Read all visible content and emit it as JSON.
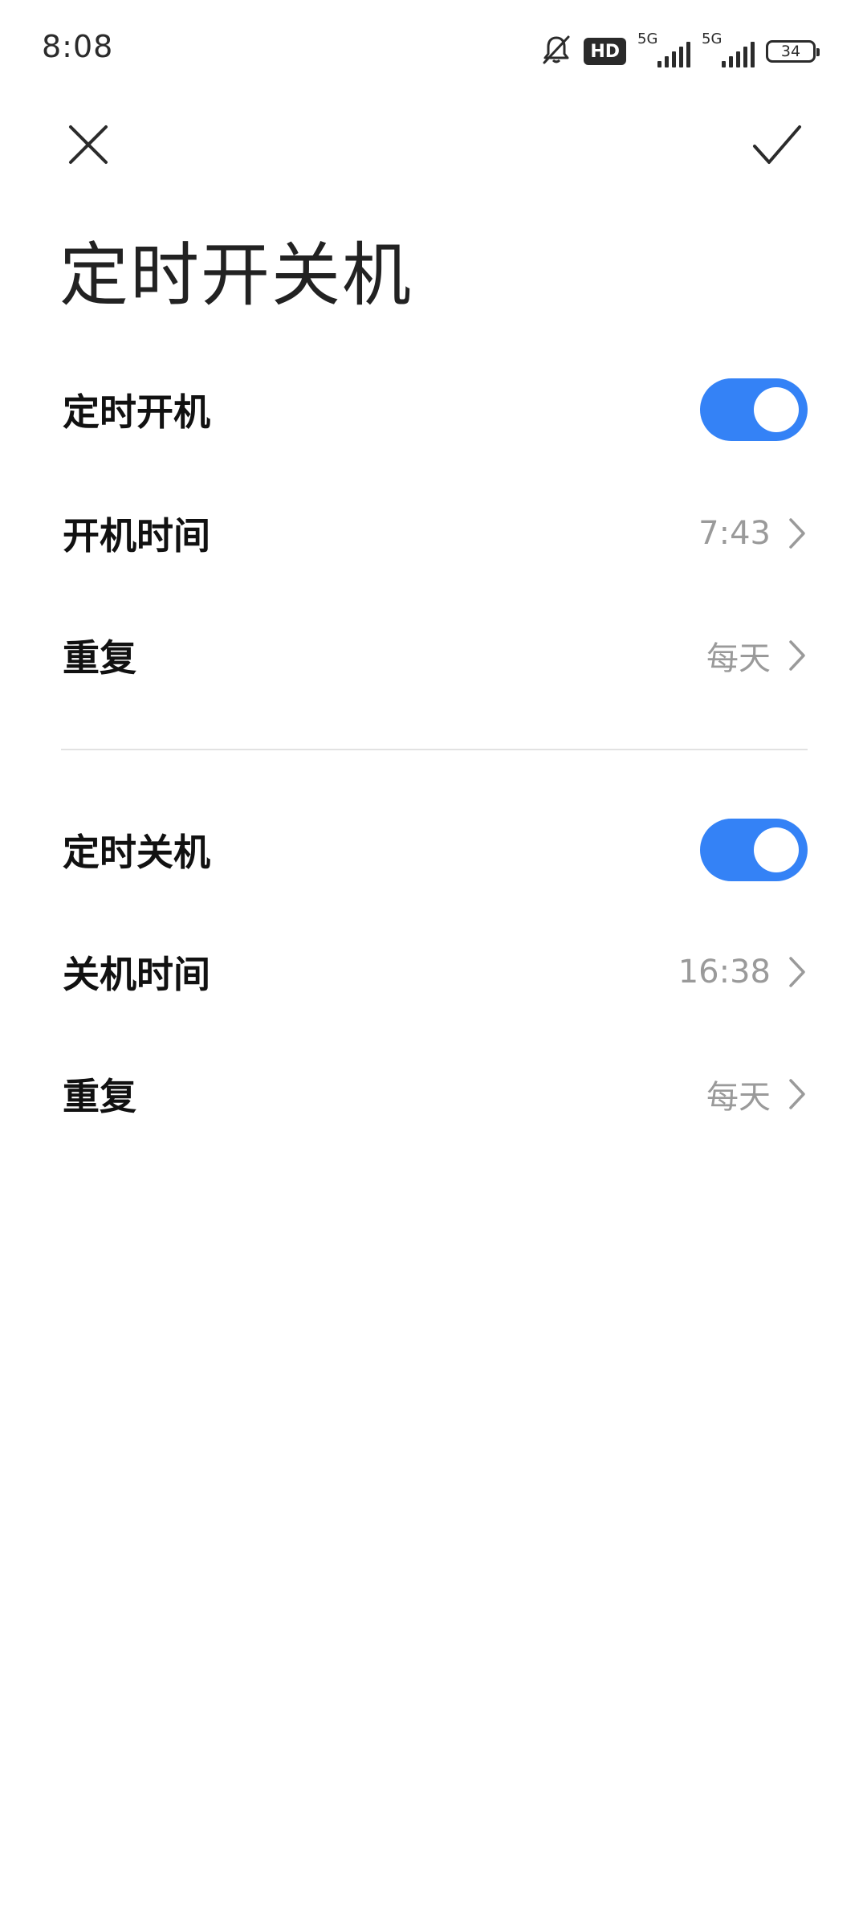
{
  "status_bar": {
    "time": "8:08",
    "hd_label": "HD",
    "network_1": "5G",
    "network_2": "5G",
    "battery": "34",
    "icons": [
      "mute-bell-icon",
      "hd-icon",
      "signal-icon",
      "signal-icon",
      "battery-icon"
    ]
  },
  "header": {
    "close_icon": "close-icon",
    "confirm_icon": "check-icon",
    "title": "定时开关机"
  },
  "power_on": {
    "toggle_label": "定时开机",
    "enabled": true,
    "time_label": "开机时间",
    "time_value": "7:43",
    "repeat_label": "重复",
    "repeat_value": "每天"
  },
  "power_off": {
    "toggle_label": "定时关机",
    "enabled": true,
    "time_label": "关机时间",
    "time_value": "16:38",
    "repeat_label": "重复",
    "repeat_value": "每天"
  },
  "colors": {
    "accent": "#3482f6",
    "secondary_text": "#9a9a9a",
    "divider": "#e2e2e2"
  }
}
